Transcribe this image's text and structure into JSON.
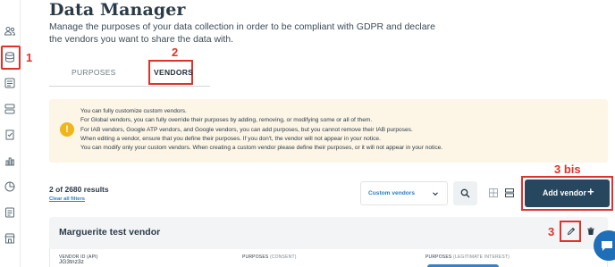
{
  "header": {
    "title": "Data Manager",
    "subtitle": "Manage the purposes of your data collection in order to be compliant with GDPR and declare the vendors you want to share the data with."
  },
  "sidebar": {
    "icons": [
      "users-icon",
      "database-icon",
      "list-icon",
      "shapes-icon",
      "check-badge-icon",
      "bar-chart-icon",
      "pie-chart-icon",
      "document-icon",
      "storefront-icon"
    ],
    "active_index": 1
  },
  "annotations": {
    "one": "1",
    "two": "2",
    "three": "3",
    "three_bis": "3 bis"
  },
  "tabs": [
    {
      "label": "PURPOSES",
      "active": false
    },
    {
      "label": "VENDORS",
      "active": true
    }
  ],
  "notice": {
    "lines": [
      "You can fully customize custom vendors.",
      "For Global vendors, you can fully override their purposes by adding, removing, or modifying some or all of them.",
      "For IAB vendors, Google ATP vendors, and Google vendors, you can add purposes, but you cannot remove their IAB purposes.",
      "When editing a vendor, ensure that you define their purposes. If you don't, the vendor will not appear in your notice.",
      "You can modify only your custom vendors. When creating a custom vendor please define their purposes, or it will not appear in your notice."
    ]
  },
  "results": {
    "count": "2 of 2680 results",
    "clear_filters": "Clear all filters"
  },
  "filter": {
    "selected": "Custom vendors"
  },
  "actions": {
    "add_vendor": "Add vendor",
    "plus": "+"
  },
  "vendor_card": {
    "name": "Marguerite test vendor",
    "vendor_id_label": "VENDOR ID (API)",
    "vendor_id": "JG3tnz3z",
    "purposes_consent_label": "PURPOSES",
    "purposes_consent_sub": "(CONSENT)",
    "purposes_li_label": "PURPOSES",
    "purposes_li_sub": "(LEGITIMATE INTEREST)"
  },
  "colors": {
    "annotation_red": "#e0312a",
    "primary_button": "#27475f",
    "link_blue": "#2b7fc7",
    "notice_bg": "#fdf5e6",
    "warning": "#f0b51b",
    "chat_blue": "#1e6fb8"
  }
}
